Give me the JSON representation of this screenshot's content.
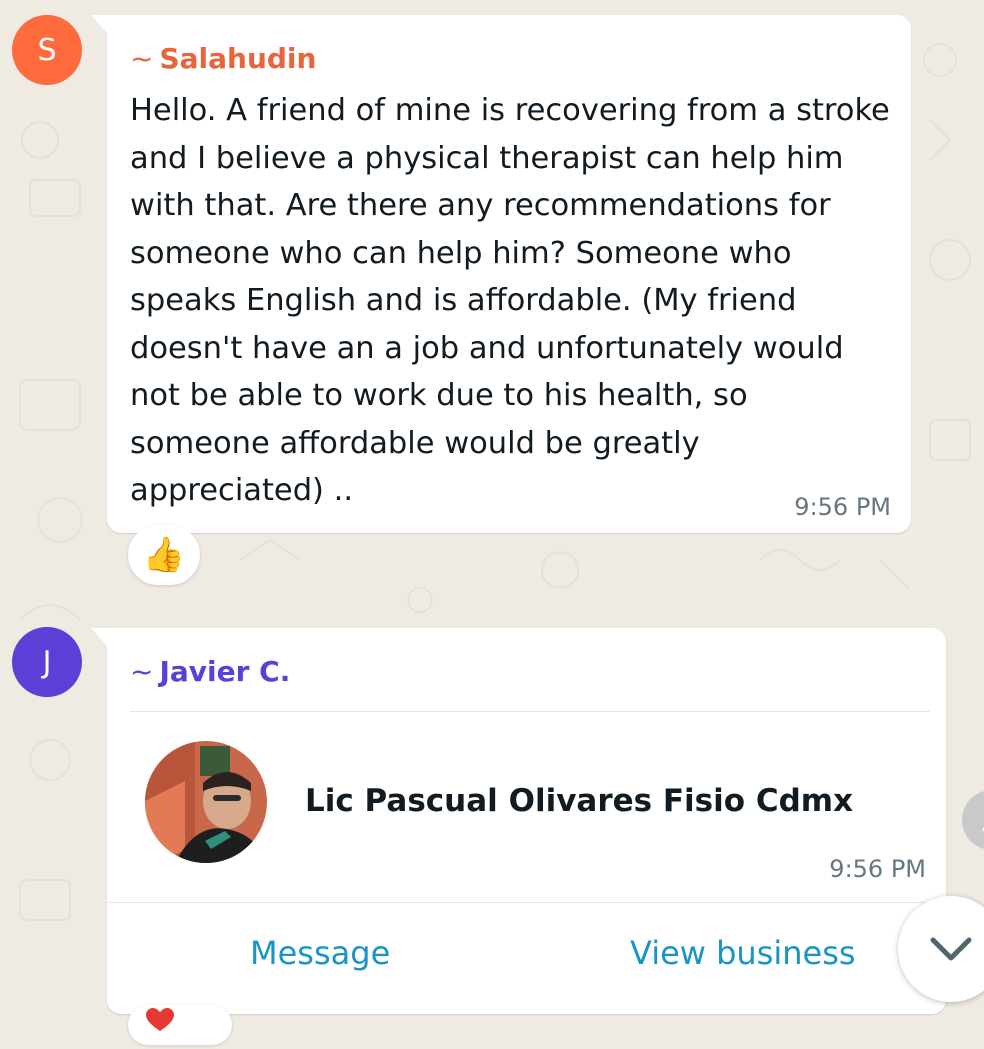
{
  "messages": [
    {
      "avatar_letter": "S",
      "avatar_color": "#ff6b3d",
      "sender_prefix": "~",
      "sender": "Salahudin",
      "sender_color": "#e8643a",
      "text": "Hello. A friend of mine is recovering from a stroke and I believe a physical therapist can help him with that. Are there any recommendations for someone who can help him? Someone who speaks English and is affordable. (My friend doesn't have an a job and unfortunately would not be able to work due to his health, so someone affordable would be greatly appreciated) ..",
      "time": "9:56 PM",
      "reaction": "👍"
    },
    {
      "avatar_letter": "J",
      "avatar_color": "#5b3fd6",
      "sender_prefix": "~",
      "sender": "Javier C.",
      "sender_color": "#5b3fd6",
      "contact_card": {
        "name": "Lic Pascual Olivares Fisio Cdmx",
        "photo_icon": "contact-photo",
        "message_label": "Message",
        "view_business_label": "View business"
      },
      "time": "9:56 PM"
    }
  ],
  "colors": {
    "background": "#efeae2",
    "link": "#1994c7",
    "time": "#667781"
  },
  "icons": {
    "scroll_down": "chevron-down-icon",
    "side_button": "forward-icon"
  }
}
